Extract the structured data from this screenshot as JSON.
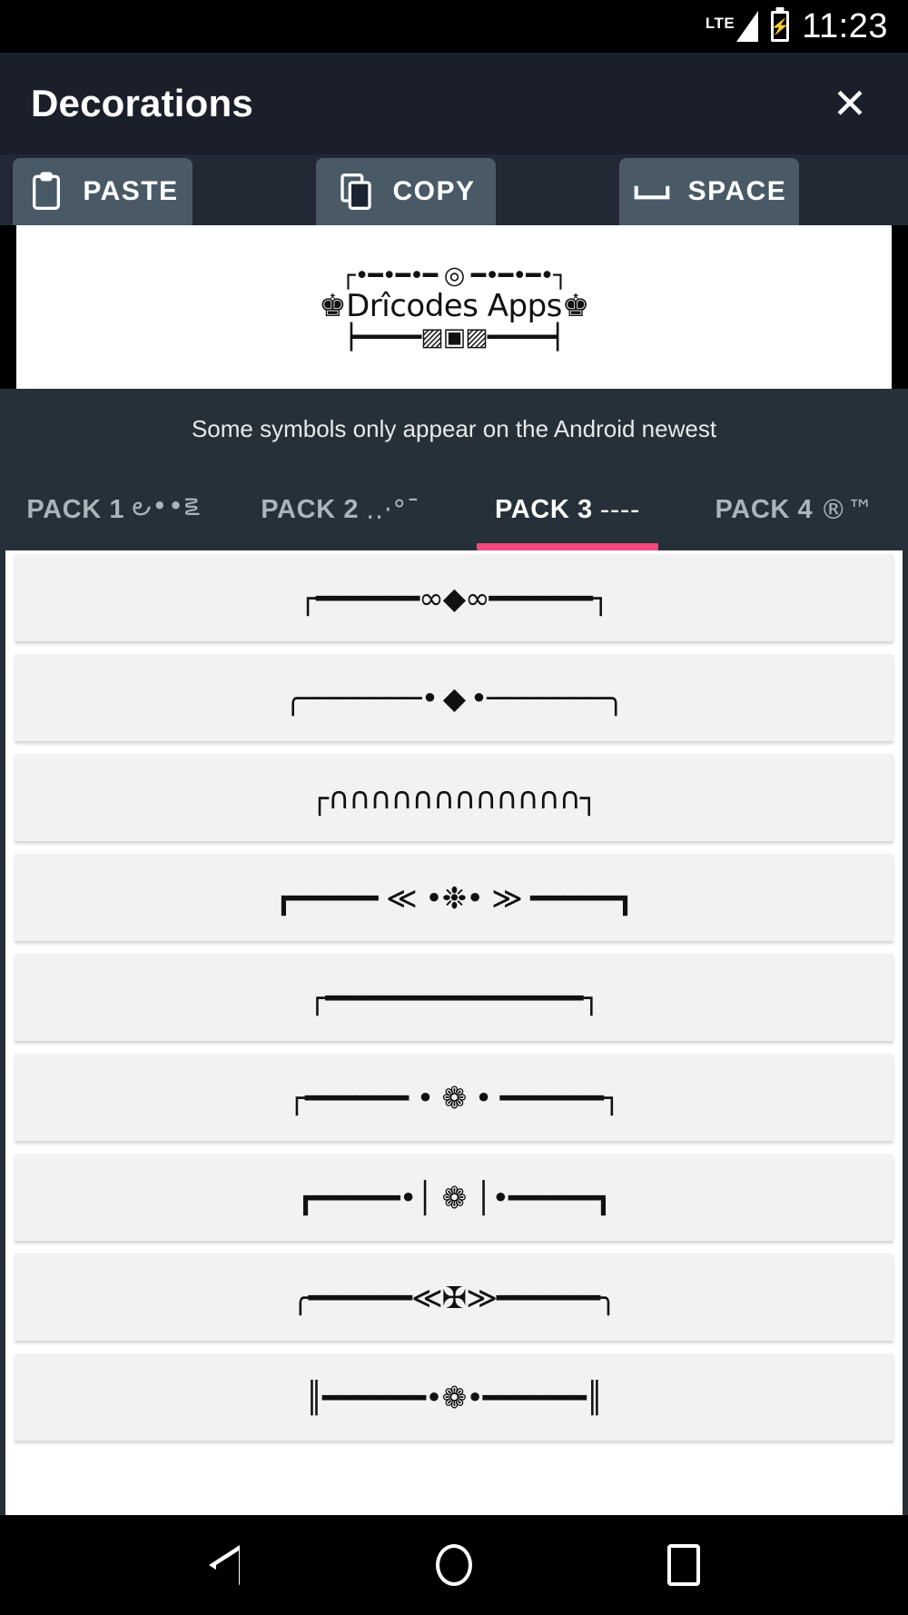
{
  "status_bar": {
    "network_label": "LTE",
    "time": "11:23",
    "battery_icon": "battery-charging-icon",
    "signal_icon": "signal-bars-icon"
  },
  "app_bar": {
    "title": "Decorations",
    "close_label": "✕"
  },
  "actions": [
    {
      "label": "PASTE",
      "icon": "clipboard-paste-icon"
    },
    {
      "label": "COPY",
      "icon": "copy-pages-icon"
    },
    {
      "label": "SPACE",
      "icon": "space-bar-icon"
    }
  ],
  "preview": {
    "line_top": "┌•━•━•━ ◎ ━•━•━•┐",
    "line_mid": "♚Drîcodes Apps♚",
    "line_bot": "▕━━━━━▨▣▨━━━━━▏"
  },
  "hint": "Some symbols only appear on the Android newest",
  "tabs": [
    {
      "label": "PACK 1",
      "symbols": "౿••౾",
      "active": false
    },
    {
      "label": "PACK 2",
      "symbols": "..·°¯",
      "active": false
    },
    {
      "label": "PACK 3",
      "symbols": "----",
      "active": true
    },
    {
      "label": "PACK 4",
      "symbols": "®™",
      "active": false
    }
  ],
  "active_tab_index": 2,
  "accent_color": "#f2487c",
  "decorations": [
    "┌━━━━━━∞◆∞━━━━━━┐",
    "╭───────• ◆ •───────╮",
    "┌∩∩∩∩∩∩∩∩∩∩∩∩┐",
    "┏━━━━━ ≪ •❉• ≫ ━━━━━┓",
    "┌━━━━━━━━━━━━━━━┐",
    "┌━━━━━━ • ❁ • ━━━━━━┐",
    "┏━━━━━•│ ❁ │•━━━━━┓",
    "╭━━━━━━≪✠≫━━━━━━╮",
    "║━━━━━━•❁•━━━━━━║"
  ],
  "nav_bar": {
    "back": "back-triangle-icon",
    "home": "home-circle-icon",
    "recents": "recents-square-icon"
  }
}
